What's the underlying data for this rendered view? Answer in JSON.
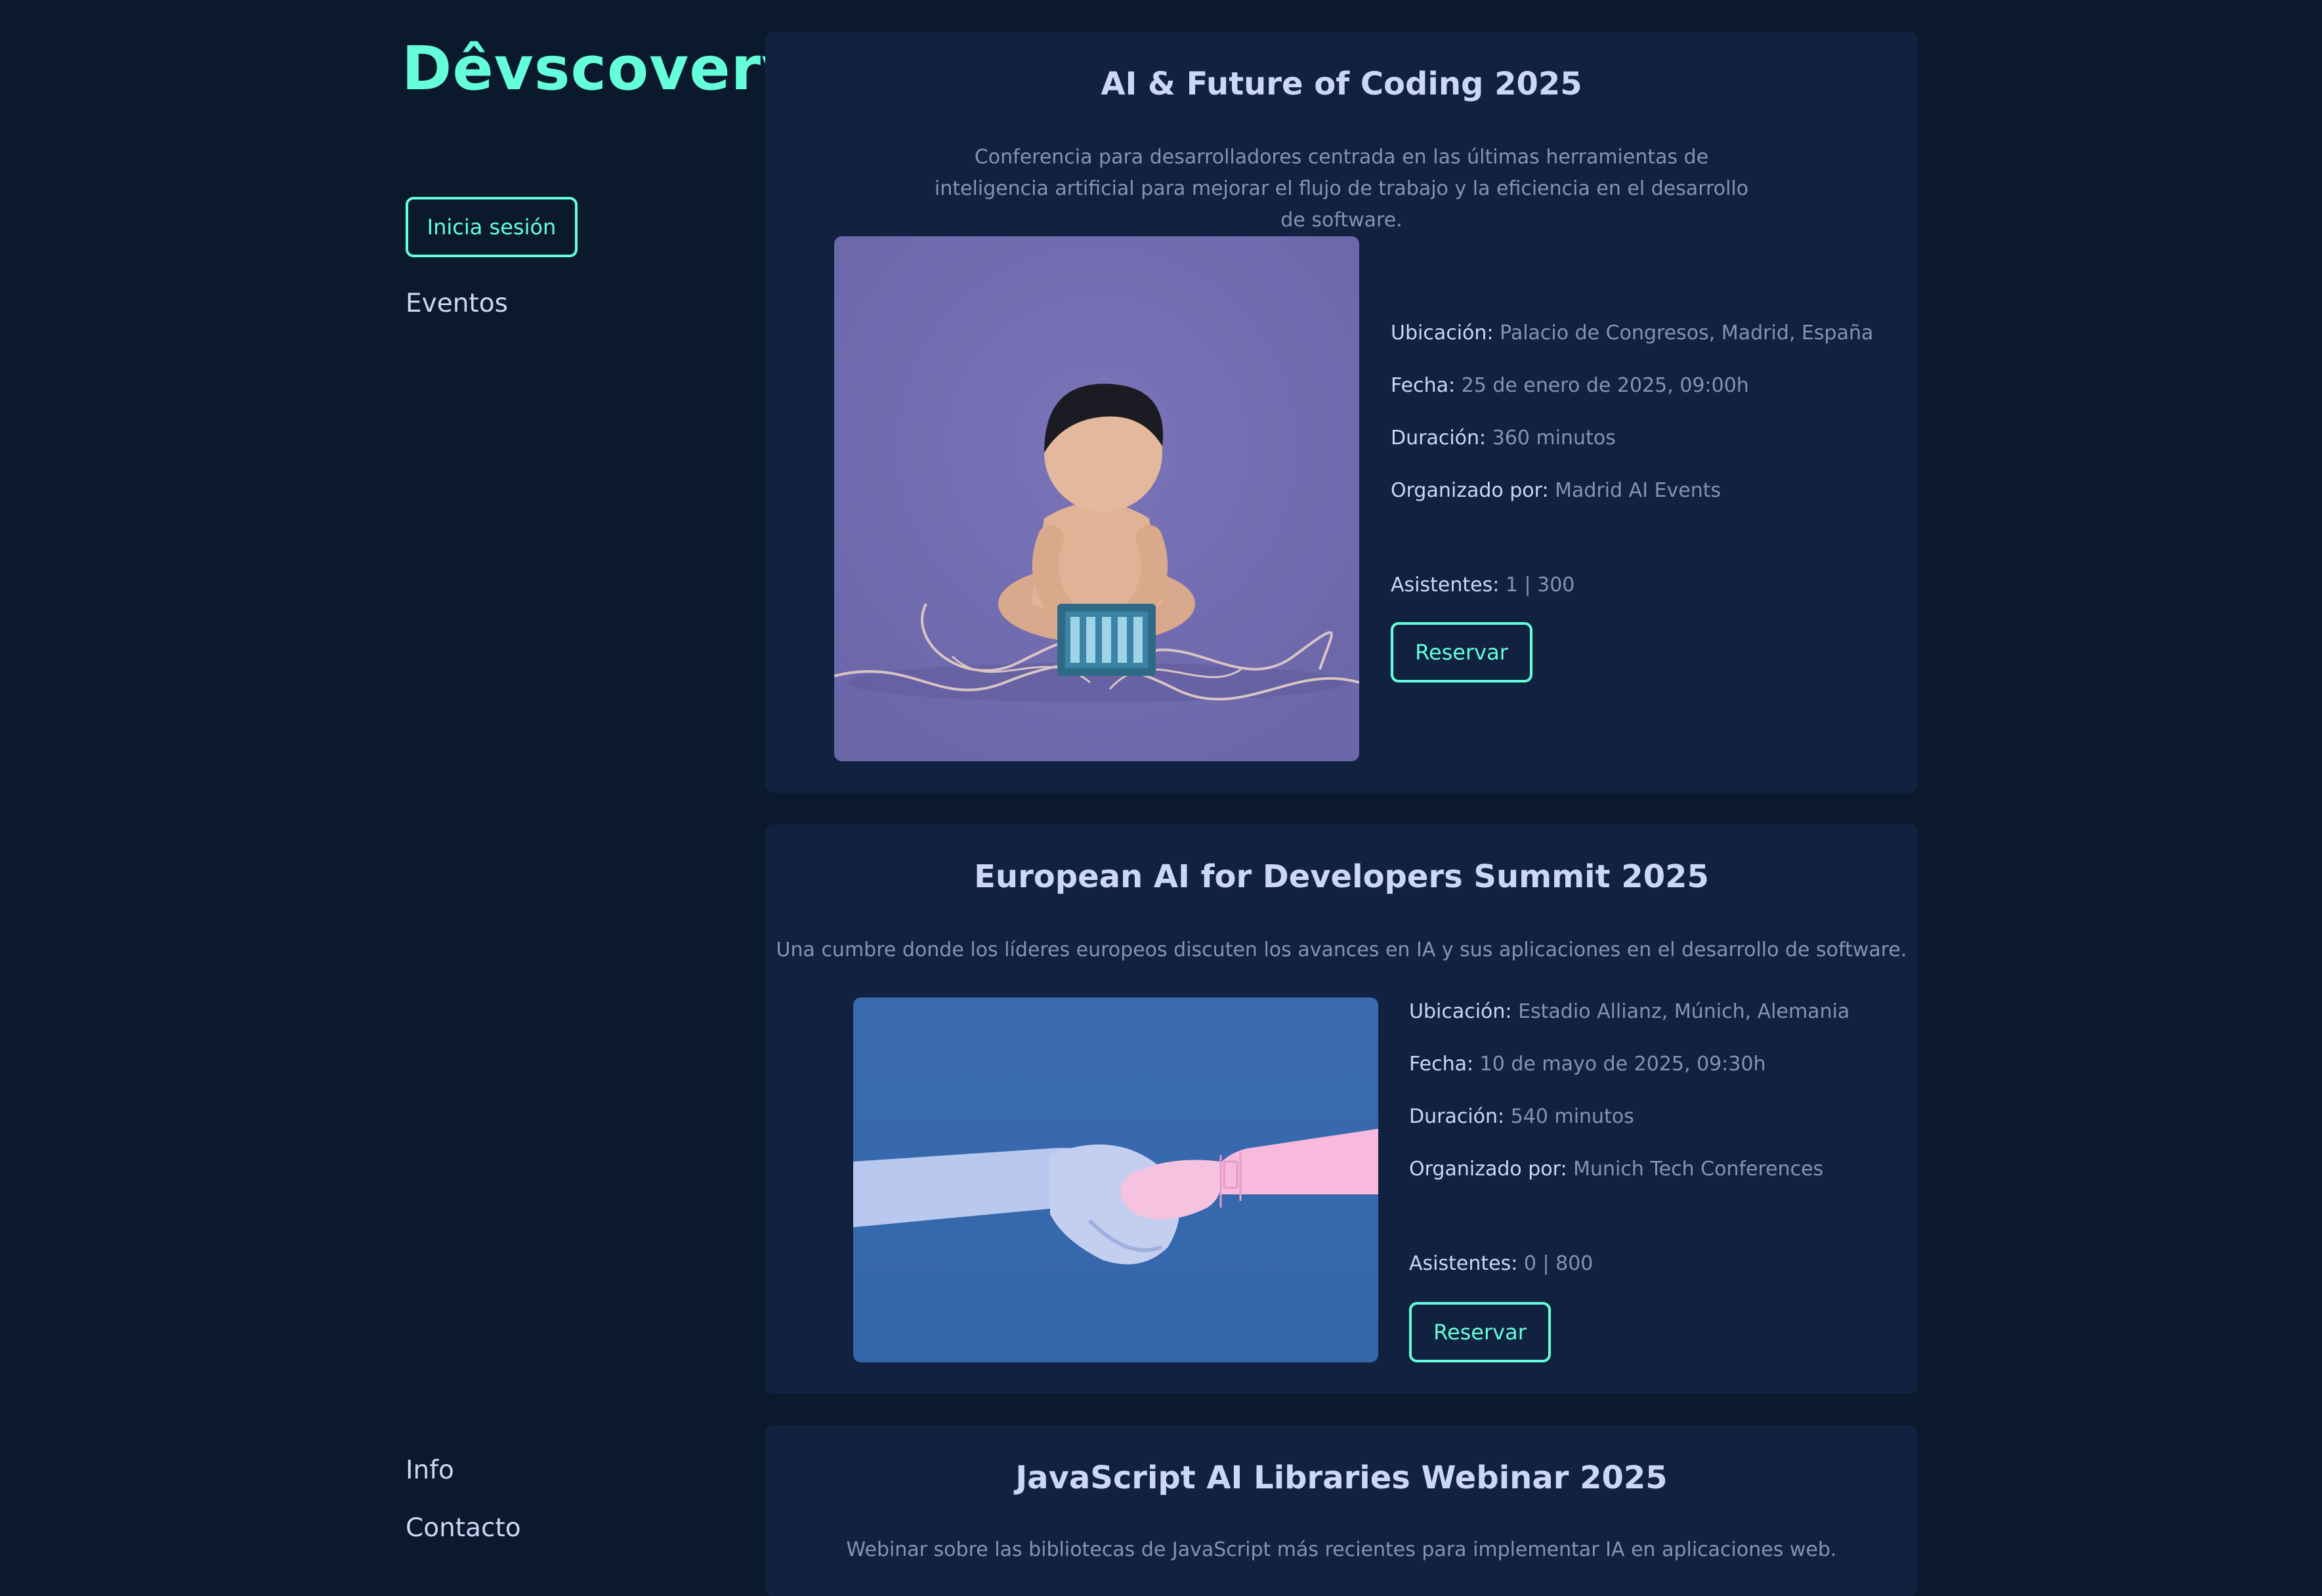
{
  "sidebar": {
    "logo": "Dêvscovery",
    "login_label": "Inicia sesión",
    "nav_events": "Eventos",
    "nav_info": "Info",
    "nav_contact": "Contacto"
  },
  "labels": {
    "location": "Ubicación:",
    "date": "Fecha:",
    "duration": "Duración:",
    "organizer": "Organizado por:",
    "attendees": "Asistentes:",
    "reserve": "Reservar"
  },
  "events": [
    {
      "title": "AI & Future of Coding 2025",
      "description": "Conferencia para desarrolladores centrada en las últimas herramientas de inteligencia artificial para mejorar el flujo de trabajo y la eficiencia en el desarrollo de software.",
      "location": "Palacio de Congresos, Madrid, España",
      "date": "25 de enero de 2025, 09:00h",
      "duration": "360 minutos",
      "organizer": "Madrid AI Events",
      "attendees": "1 | 300",
      "image_icon": "baby-with-circuit-board-icon"
    },
    {
      "title": "European AI for Developers Summit 2025",
      "description": "Una cumbre donde los líderes europeos discuten los avances en IA y sus aplicaciones en el desarrollo de software.",
      "location": "Estadio Allianz, Múnich, Alemania",
      "date": "10 de mayo de 2025, 09:30h",
      "duration": "540 minutos",
      "organizer": "Munich Tech Conferences",
      "attendees": "0 | 800",
      "image_icon": "human-robot-handshake-icon"
    },
    {
      "title": "JavaScript AI Libraries Webinar 2025",
      "description": "Webinar sobre las bibliotecas de JavaScript más recientes para implementar IA en aplicaciones web."
    }
  ],
  "colors": {
    "background": "#0b192c",
    "card": "#112240",
    "accent": "#64ffda",
    "text_light": "#ccd6f6",
    "text_muted": "#8892b0"
  }
}
